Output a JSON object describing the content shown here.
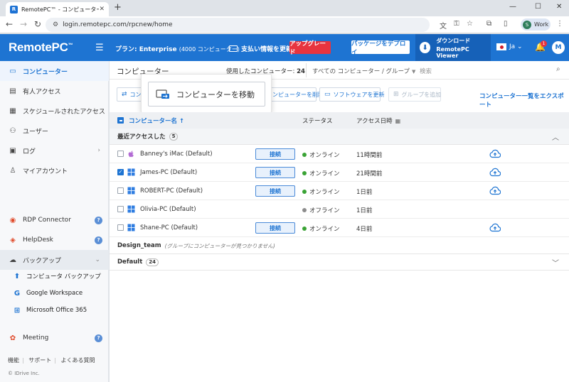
{
  "browser": {
    "tab_title": "RemotePC™ - コンピューター",
    "tab_favicon": "R",
    "url": "login.remotepc.com/rpcnew/home",
    "profile_initial": "S",
    "profile_label": "Work",
    "controls": {
      "minimize": "—",
      "maximize": "☐",
      "close": "✕"
    }
  },
  "header": {
    "logo": "RemotePC",
    "logo_mark": "™",
    "plan_label": "プラン: Enterprise",
    "plan_detail": "(4000 コンピューター)",
    "payment_label": "支払い情報を更新",
    "upgrade_label": "アップグレード",
    "deploy_label": "パッケージをデプロイ",
    "download_line1": "ダウンロード",
    "download_line2": "RemotePC Viewer",
    "language": "Ja",
    "notification_count": "1",
    "user_initial": "M",
    "accent": "#1e74d2",
    "upgrade_color": "#e8343f"
  },
  "sidebar": {
    "items": [
      {
        "label": "コンピューター",
        "icon": "monitor-icon"
      },
      {
        "label": "有人アクセス",
        "icon": "attended-access-icon"
      },
      {
        "label": "スケジュールされたアクセス",
        "icon": "calendar-icon"
      },
      {
        "label": "ユーザー",
        "icon": "users-icon"
      },
      {
        "label": "ログ",
        "icon": "logs-icon"
      },
      {
        "label": "マイアカウント",
        "icon": "account-icon"
      }
    ],
    "services": [
      {
        "label": "RDP Connector",
        "icon": "rdp-icon"
      },
      {
        "label": "HelpDesk",
        "icon": "helpdesk-icon"
      },
      {
        "label": "バックアップ",
        "icon": "backup-icon"
      }
    ],
    "backup_sub": [
      {
        "label": "コンピュータ バックアップ",
        "icon": "computer-backup-icon"
      },
      {
        "label": "Google Workspace",
        "icon": "google-icon"
      },
      {
        "label": "Microsoft Office 365",
        "icon": "office365-icon"
      }
    ],
    "meeting": {
      "label": "Meeting",
      "icon": "meeting-icon"
    },
    "footer_links": [
      "機能",
      "サポート",
      "よくある質問"
    ],
    "copyright": "© IDrive Inc."
  },
  "main": {
    "title": "コンピューター",
    "used_label": "使用したコンピューター:",
    "used_count": "24",
    "group_filter": "すべての コンピューター / グループ",
    "search_placeholder": "検索",
    "actions": {
      "first_partial": "コン",
      "remove": "コンピューターを削除",
      "update": "ソフトウェアを更新",
      "add_group": "グループを追加",
      "export": "コンピューター一覧をエクスポート"
    },
    "popup_move": "コンピューターを移動",
    "columns": {
      "name": "コンピューター名",
      "sort": "↑",
      "status": "ステータス",
      "access": "アクセス日時"
    },
    "recent_group": {
      "label": "最近アクセスした",
      "count": "5"
    },
    "computers": [
      {
        "name": "Banney's iMac (Default)",
        "os": "apple-icon",
        "connect": "接続",
        "status": "オンライン",
        "online": true,
        "access": "11時間前",
        "checked": false,
        "cloud": true
      },
      {
        "name": "James-PC (Default)",
        "os": "windows-icon",
        "connect": "接続",
        "status": "オンライン",
        "online": true,
        "access": "21時間前",
        "checked": true,
        "cloud": true
      },
      {
        "name": "ROBERT-PC (Default)",
        "os": "windows-icon",
        "connect": "接続",
        "status": "オンライン",
        "online": true,
        "access": "1日前",
        "checked": false,
        "cloud": true
      },
      {
        "name": "Olivia-PC (Default)",
        "os": "windows-icon",
        "connect": "",
        "status": "オフライン",
        "online": false,
        "access": "1日前",
        "checked": false,
        "cloud": false
      },
      {
        "name": "Shane-PC (Default)",
        "os": "windows-icon",
        "connect": "接続",
        "status": "オンライン",
        "online": true,
        "access": "4日前",
        "checked": false,
        "cloud": true
      }
    ],
    "design_group": {
      "label": "Design_team",
      "note": "(グループにコンピューターが見つかりません)"
    },
    "default_group": {
      "label": "Default",
      "count": "24"
    },
    "online_color": "#3aa335",
    "offline_color": "#8c8c8c"
  }
}
